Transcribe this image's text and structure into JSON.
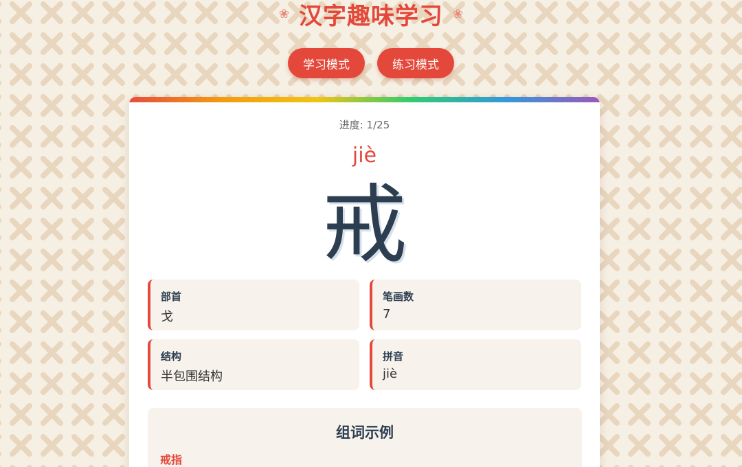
{
  "header": {
    "title": "汉字趣味学习",
    "decor_left_icon": "flower-icon",
    "decor_right_icon": "flower-icon"
  },
  "modes": {
    "learn_label": "学习模式",
    "practice_label": "练习模式"
  },
  "card": {
    "progress": "进度: 1/25",
    "pinyin": "jiè",
    "character": "戒",
    "info": {
      "radical": {
        "label": "部首",
        "value": "戈"
      },
      "strokes": {
        "label": "笔画数",
        "value": "7"
      },
      "structure": {
        "label": "结构",
        "value": "半包围结构"
      },
      "pinyin": {
        "label": "拼音",
        "value": "jiè"
      }
    },
    "words": {
      "title": "组词示例",
      "items": [
        "戒指"
      ]
    }
  },
  "colors": {
    "accent": "#e4483a",
    "text_dark": "#2c3e50",
    "info_bg": "#f7f3ec",
    "page_bg": "#f6efe3"
  }
}
